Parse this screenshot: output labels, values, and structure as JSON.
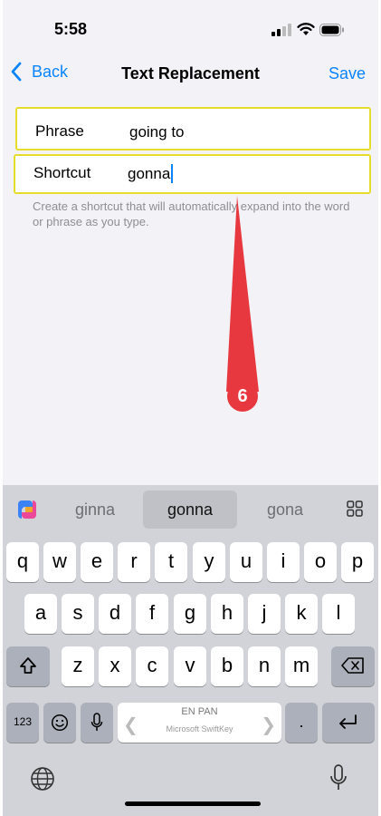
{
  "status": {
    "time": "5:58"
  },
  "nav": {
    "back_label": "Back",
    "title": "Text Replacement",
    "save_label": "Save"
  },
  "form": {
    "phrase_label": "Phrase",
    "phrase_value": "going to",
    "shortcut_label": "Shortcut",
    "shortcut_value": "gonna",
    "help_text": "Create a shortcut that will automatically expand into the word or phrase as you type."
  },
  "annotation": {
    "step_number": "6"
  },
  "keyboard": {
    "suggestions": [
      "ginna",
      "gonna",
      "gona"
    ],
    "row1": [
      "q",
      "w",
      "e",
      "r",
      "t",
      "y",
      "u",
      "i",
      "o",
      "p"
    ],
    "row2": [
      "a",
      "s",
      "d",
      "f",
      "g",
      "h",
      "j",
      "k",
      "l"
    ],
    "row3": [
      "z",
      "x",
      "c",
      "v",
      "b",
      "n",
      "m"
    ],
    "numbers_key": "123",
    "space_language": "EN PAN",
    "space_brand": "Microsoft SwiftKey",
    "period_key": "."
  },
  "colors": {
    "accent": "#0a84ff",
    "highlight_border": "#e6dd2a",
    "annotation": "#e8383f"
  }
}
